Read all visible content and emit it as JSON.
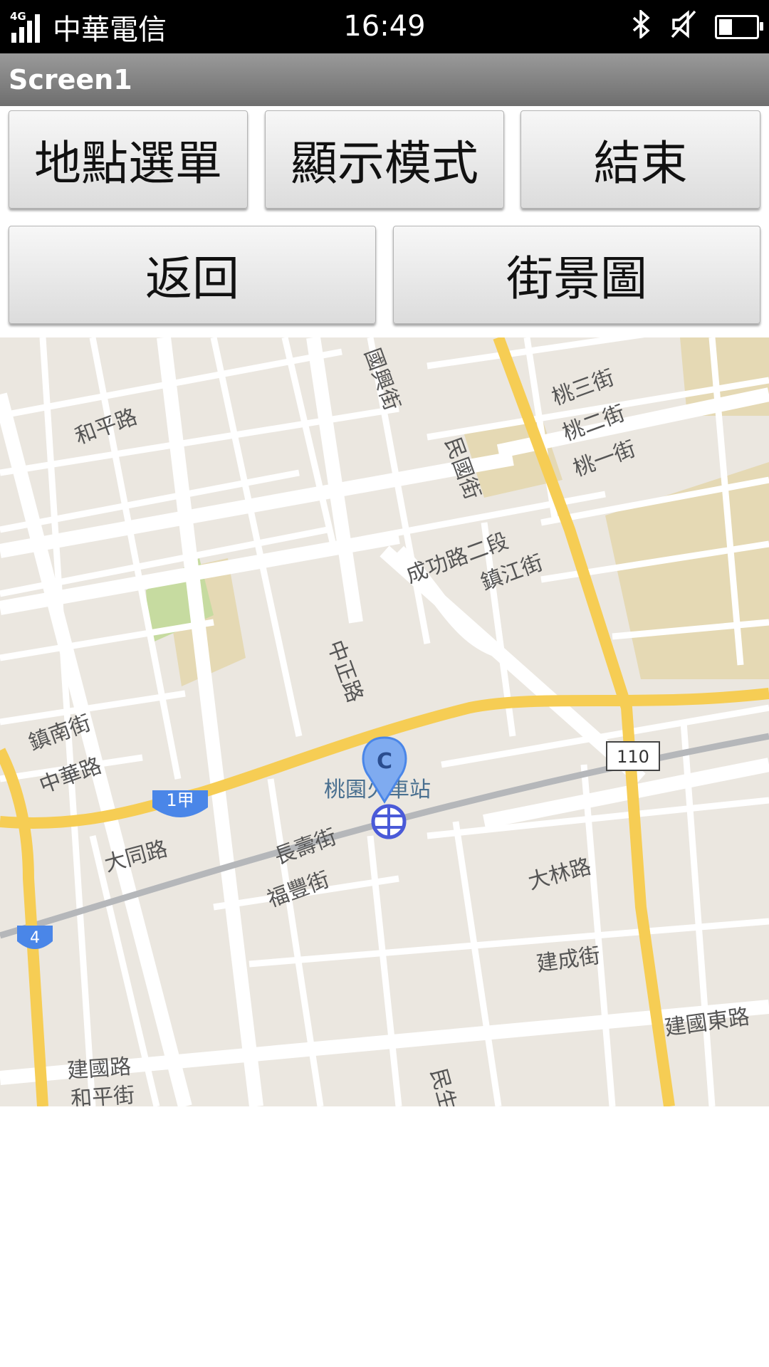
{
  "status_bar": {
    "network_type": "4G",
    "carrier": "中華電信",
    "time": "16:49",
    "icons": [
      "signal-icon",
      "bluetooth-icon",
      "silent-icon",
      "battery-icon"
    ],
    "battery_level": 0.35
  },
  "titlebar": {
    "title": "Screen1"
  },
  "buttons": {
    "location_menu": "地點選單",
    "display_mode": "顯示模式",
    "end": "結束",
    "back": "返回",
    "street_view": "街景圖"
  },
  "map": {
    "marker_label": "C",
    "marker_color": "#4a86e8",
    "station_name": "桃園火車站",
    "labels": {
      "heping_rd": "和平路",
      "taoyuan_3": "桃三街",
      "taoyuan_2": "桃二街",
      "taoyuan_1": "桃一街",
      "guoxing_st": "國興街",
      "minguo_st": "民國街",
      "chenggong_rd": "成功路二段",
      "zhenjiang_st": "鎮江街",
      "zhongzheng_rd": "中正路",
      "zhennan_st": "鎮南街",
      "zhonghua_rd": "中華路",
      "datong_rd": "大同路",
      "changshou_st": "長壽街",
      "fufeng_st": "福豐街",
      "dalin_rd": "大林路",
      "jiancheng_st": "建成街",
      "jianguo_e_rd": "建國東路",
      "jianguo_rd": "建國路",
      "minsheng_rd": "民生路",
      "heping_st": "和平街"
    },
    "shields": {
      "route_1a": "1甲",
      "route_4": "4",
      "route_110": "110"
    },
    "colors": {
      "land": "#ebe7e0",
      "road": "#ffffff",
      "highway": "#f6cd54",
      "park": "#c6dba0",
      "campus": "#e5d9b4",
      "rail": "#b5b7ba"
    }
  }
}
